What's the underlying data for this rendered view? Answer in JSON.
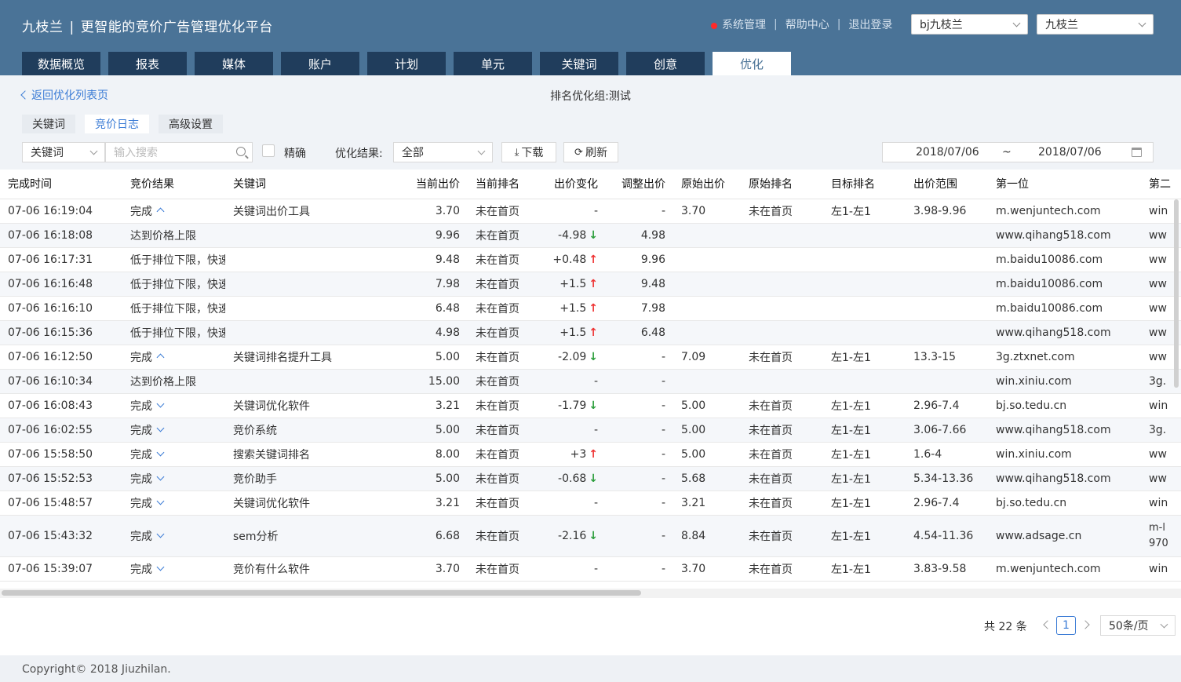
{
  "header": {
    "brand": "九枝兰",
    "brand_sep": "|",
    "slogan": "更智能的竞价广告管理优化平台",
    "links": [
      "系统管理",
      "帮助中心",
      "退出登录"
    ],
    "link_sep": "|",
    "account_select": "bj九枝兰",
    "user_select": "九枝兰"
  },
  "nav": {
    "tabs": [
      "数据概览",
      "报表",
      "媒体",
      "账户",
      "计划",
      "单元",
      "关键词",
      "创意",
      "优化"
    ],
    "active_index": 8
  },
  "sub": {
    "back_label": "返回优化列表页",
    "group_title": "排名优化组:测试",
    "tabs": [
      "关键词",
      "竞价日志",
      "高级设置"
    ],
    "active_tab_index": 1
  },
  "filters": {
    "field_select": "关键词",
    "search_placeholder": "输入搜索",
    "exact_label": "精确",
    "result_label": "优化结果:",
    "result_select": "全部",
    "download_label": "下载",
    "refresh_label": "刷新",
    "date_from": "2018/07/06",
    "date_sep": "~",
    "date_to": "2018/07/06"
  },
  "table": {
    "columns": [
      "完成时间",
      "竞价结果",
      "关键词",
      "当前出价",
      "当前排名",
      "出价变化",
      "调整出价",
      "原始出价",
      "原始排名",
      "目标排名",
      "出价范围",
      "第一位",
      "第二"
    ],
    "rows": [
      [
        "07-06 16:19:04",
        "完成",
        "up",
        "关键词出价工具",
        "3.70",
        "未在首页",
        "-",
        "",
        "-",
        "3.70",
        "未在首页",
        "左1-左1",
        "3.98-9.96",
        "m.wenjuntech.com",
        "win"
      ],
      [
        "07-06 16:18:08",
        "达到价格上限",
        "",
        "",
        "9.96",
        "未在首页",
        "-4.98",
        "down",
        "4.98",
        "",
        "",
        "",
        "",
        "www.qihang518.com",
        "ww"
      ],
      [
        "07-06 16:17:31",
        "低于排位下限，快速锁定排位",
        "",
        "",
        "9.48",
        "未在首页",
        "+0.48",
        "up",
        "9.96",
        "",
        "",
        "",
        "",
        "m.baidu10086.com",
        "ww"
      ],
      [
        "07-06 16:16:48",
        "低于排位下限，快速锁定排位",
        "",
        "",
        "7.98",
        "未在首页",
        "+1.5",
        "up",
        "9.48",
        "",
        "",
        "",
        "",
        "m.baidu10086.com",
        "ww"
      ],
      [
        "07-06 16:16:10",
        "低于排位下限，快速锁定排位",
        "",
        "",
        "6.48",
        "未在首页",
        "+1.5",
        "up",
        "7.98",
        "",
        "",
        "",
        "",
        "m.baidu10086.com",
        "ww"
      ],
      [
        "07-06 16:15:36",
        "低于排位下限，快速锁定排位",
        "",
        "",
        "4.98",
        "未在首页",
        "+1.5",
        "up",
        "6.48",
        "",
        "",
        "",
        "",
        "www.qihang518.com",
        "ww"
      ],
      [
        "07-06 16:12:50",
        "完成",
        "up",
        "关键词排名提升工具",
        "5.00",
        "未在首页",
        "-2.09",
        "down",
        "-",
        "7.09",
        "未在首页",
        "左1-左1",
        "13.3-15",
        "3g.ztxnet.com",
        "ww"
      ],
      [
        "07-06 16:10:34",
        "达到价格上限",
        "",
        "",
        "15.00",
        "未在首页",
        "-",
        "",
        "-",
        "",
        "",
        "",
        "",
        "win.xiniu.com",
        "3g."
      ],
      [
        "07-06 16:08:43",
        "完成",
        "down",
        "关键词优化软件",
        "3.21",
        "未在首页",
        "-1.79",
        "down",
        "-",
        "5.00",
        "未在首页",
        "左1-左1",
        "2.96-7.4",
        "bj.so.tedu.cn",
        "win"
      ],
      [
        "07-06 16:02:55",
        "完成",
        "down",
        "竞价系统",
        "5.00",
        "未在首页",
        "-",
        "",
        "-",
        "5.00",
        "未在首页",
        "左1-左1",
        "3.06-7.66",
        "www.qihang518.com",
        "3g."
      ],
      [
        "07-06 15:58:50",
        "完成",
        "down",
        "搜索关键词排名",
        "8.00",
        "未在首页",
        "+3",
        "up",
        "-",
        "5.00",
        "未在首页",
        "左1-左1",
        "1.6-4",
        "win.xiniu.com",
        "ww"
      ],
      [
        "07-06 15:52:53",
        "完成",
        "down",
        "竞价助手",
        "5.00",
        "未在首页",
        "-0.68",
        "down",
        "-",
        "5.68",
        "未在首页",
        "左1-左1",
        "5.34-13.36",
        "www.qihang518.com",
        "ww"
      ],
      [
        "07-06 15:48:57",
        "完成",
        "down",
        "关键词优化软件",
        "3.21",
        "未在首页",
        "-",
        "",
        "-",
        "3.21",
        "未在首页",
        "左1-左1",
        "2.96-7.4",
        "bj.so.tedu.cn",
        "win"
      ],
      [
        "07-06 15:43:32",
        "完成",
        "down",
        "sem分析",
        "6.68",
        "未在首页",
        "-2.16",
        "down",
        "-",
        "8.84",
        "未在首页",
        "左1-左1",
        "4.54-11.36",
        "www.adsage.cn",
        "m-l 970"
      ],
      [
        "07-06 15:39:07",
        "完成",
        "down",
        "竞价有什么软件",
        "3.70",
        "未在首页",
        "-",
        "",
        "-",
        "3.70",
        "未在首页",
        "左1-左1",
        "3.83-9.58",
        "m.wenjuntech.com",
        "win"
      ]
    ]
  },
  "pagination": {
    "total": "共 22 条",
    "current_page": "1",
    "page_size": "50条/页"
  },
  "footer": {
    "copyright": "Copyright© 2018 Jiuzhilan."
  },
  "colors": {
    "header_bg": "#4a7397",
    "tab_bg": "#203d5c",
    "accent": "#3a7bd5",
    "up": "#ee3333",
    "down": "#2a9d3a"
  }
}
